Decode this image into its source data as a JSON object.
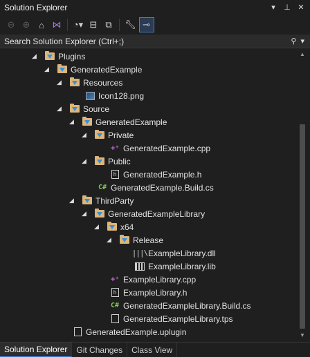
{
  "window": {
    "title": "Solution Explorer"
  },
  "toolbar": {
    "buttons": [
      {
        "name": "back-icon"
      },
      {
        "name": "forward-icon"
      },
      {
        "name": "home-icon"
      },
      {
        "name": "switch-views-icon"
      },
      {
        "name": "pending-changes-filter-icon"
      },
      {
        "name": "collapse-all-icon"
      },
      {
        "name": "show-all-files-icon"
      },
      {
        "name": "properties-icon"
      },
      {
        "name": "preview-selected-items-icon"
      }
    ]
  },
  "search": {
    "placeholder": "Search Solution Explorer (Ctrl+;)"
  },
  "tree": [
    {
      "label": "Plugins",
      "icon": "folder-filter-icon",
      "expanded": true
    },
    {
      "label": "GeneratedExample",
      "icon": "folder-filter-icon",
      "expanded": true
    },
    {
      "label": "Resources",
      "icon": "folder-filter-icon",
      "expanded": true
    },
    {
      "label": "Icon128.png",
      "icon": "image-file-icon"
    },
    {
      "label": "Source",
      "icon": "folder-filter-icon",
      "expanded": true
    },
    {
      "label": "GeneratedExample",
      "icon": "folder-filter-icon",
      "expanded": true
    },
    {
      "label": "Private",
      "icon": "folder-filter-icon",
      "expanded": true
    },
    {
      "label": "GeneratedExample.cpp",
      "icon": "cpp-file-icon"
    },
    {
      "label": "Public",
      "icon": "folder-filter-icon",
      "expanded": true
    },
    {
      "label": "GeneratedExample.h",
      "icon": "header-file-icon"
    },
    {
      "label": "GeneratedExample.Build.cs",
      "icon": "csharp-file-icon"
    },
    {
      "label": "ThirdParty",
      "icon": "folder-filter-icon",
      "expanded": true
    },
    {
      "label": "GeneratedExampleLibrary",
      "icon": "folder-filter-icon",
      "expanded": true
    },
    {
      "label": "x64",
      "icon": "folder-filter-icon",
      "expanded": true
    },
    {
      "label": "Release",
      "icon": "folder-filter-icon",
      "expanded": true
    },
    {
      "label": "ExampleLibrary.dll",
      "icon": "dll-file-icon"
    },
    {
      "label": "ExampleLibrary.lib",
      "icon": "lib-file-icon"
    },
    {
      "label": "ExampleLibrary.cpp",
      "icon": "cpp-file-icon"
    },
    {
      "label": "ExampleLibrary.h",
      "icon": "header-file-icon"
    },
    {
      "label": "GeneratedExampleLibrary.Build.cs",
      "icon": "csharp-file-icon"
    },
    {
      "label": "GeneratedExampleLibrary.tps",
      "icon": "text-file-icon"
    },
    {
      "label": "GeneratedExample.uplugin",
      "icon": "text-file-icon"
    }
  ],
  "tabs": [
    {
      "label": "Solution Explorer",
      "active": true
    },
    {
      "label": "Git Changes",
      "active": false
    },
    {
      "label": "Class View",
      "active": false
    }
  ],
  "colors": {
    "background": "#1f1f1f",
    "folder": "#dcb67a",
    "accent": "#3d7fd6",
    "cpp": "#c46cd6",
    "csharp": "#7fc94f"
  }
}
